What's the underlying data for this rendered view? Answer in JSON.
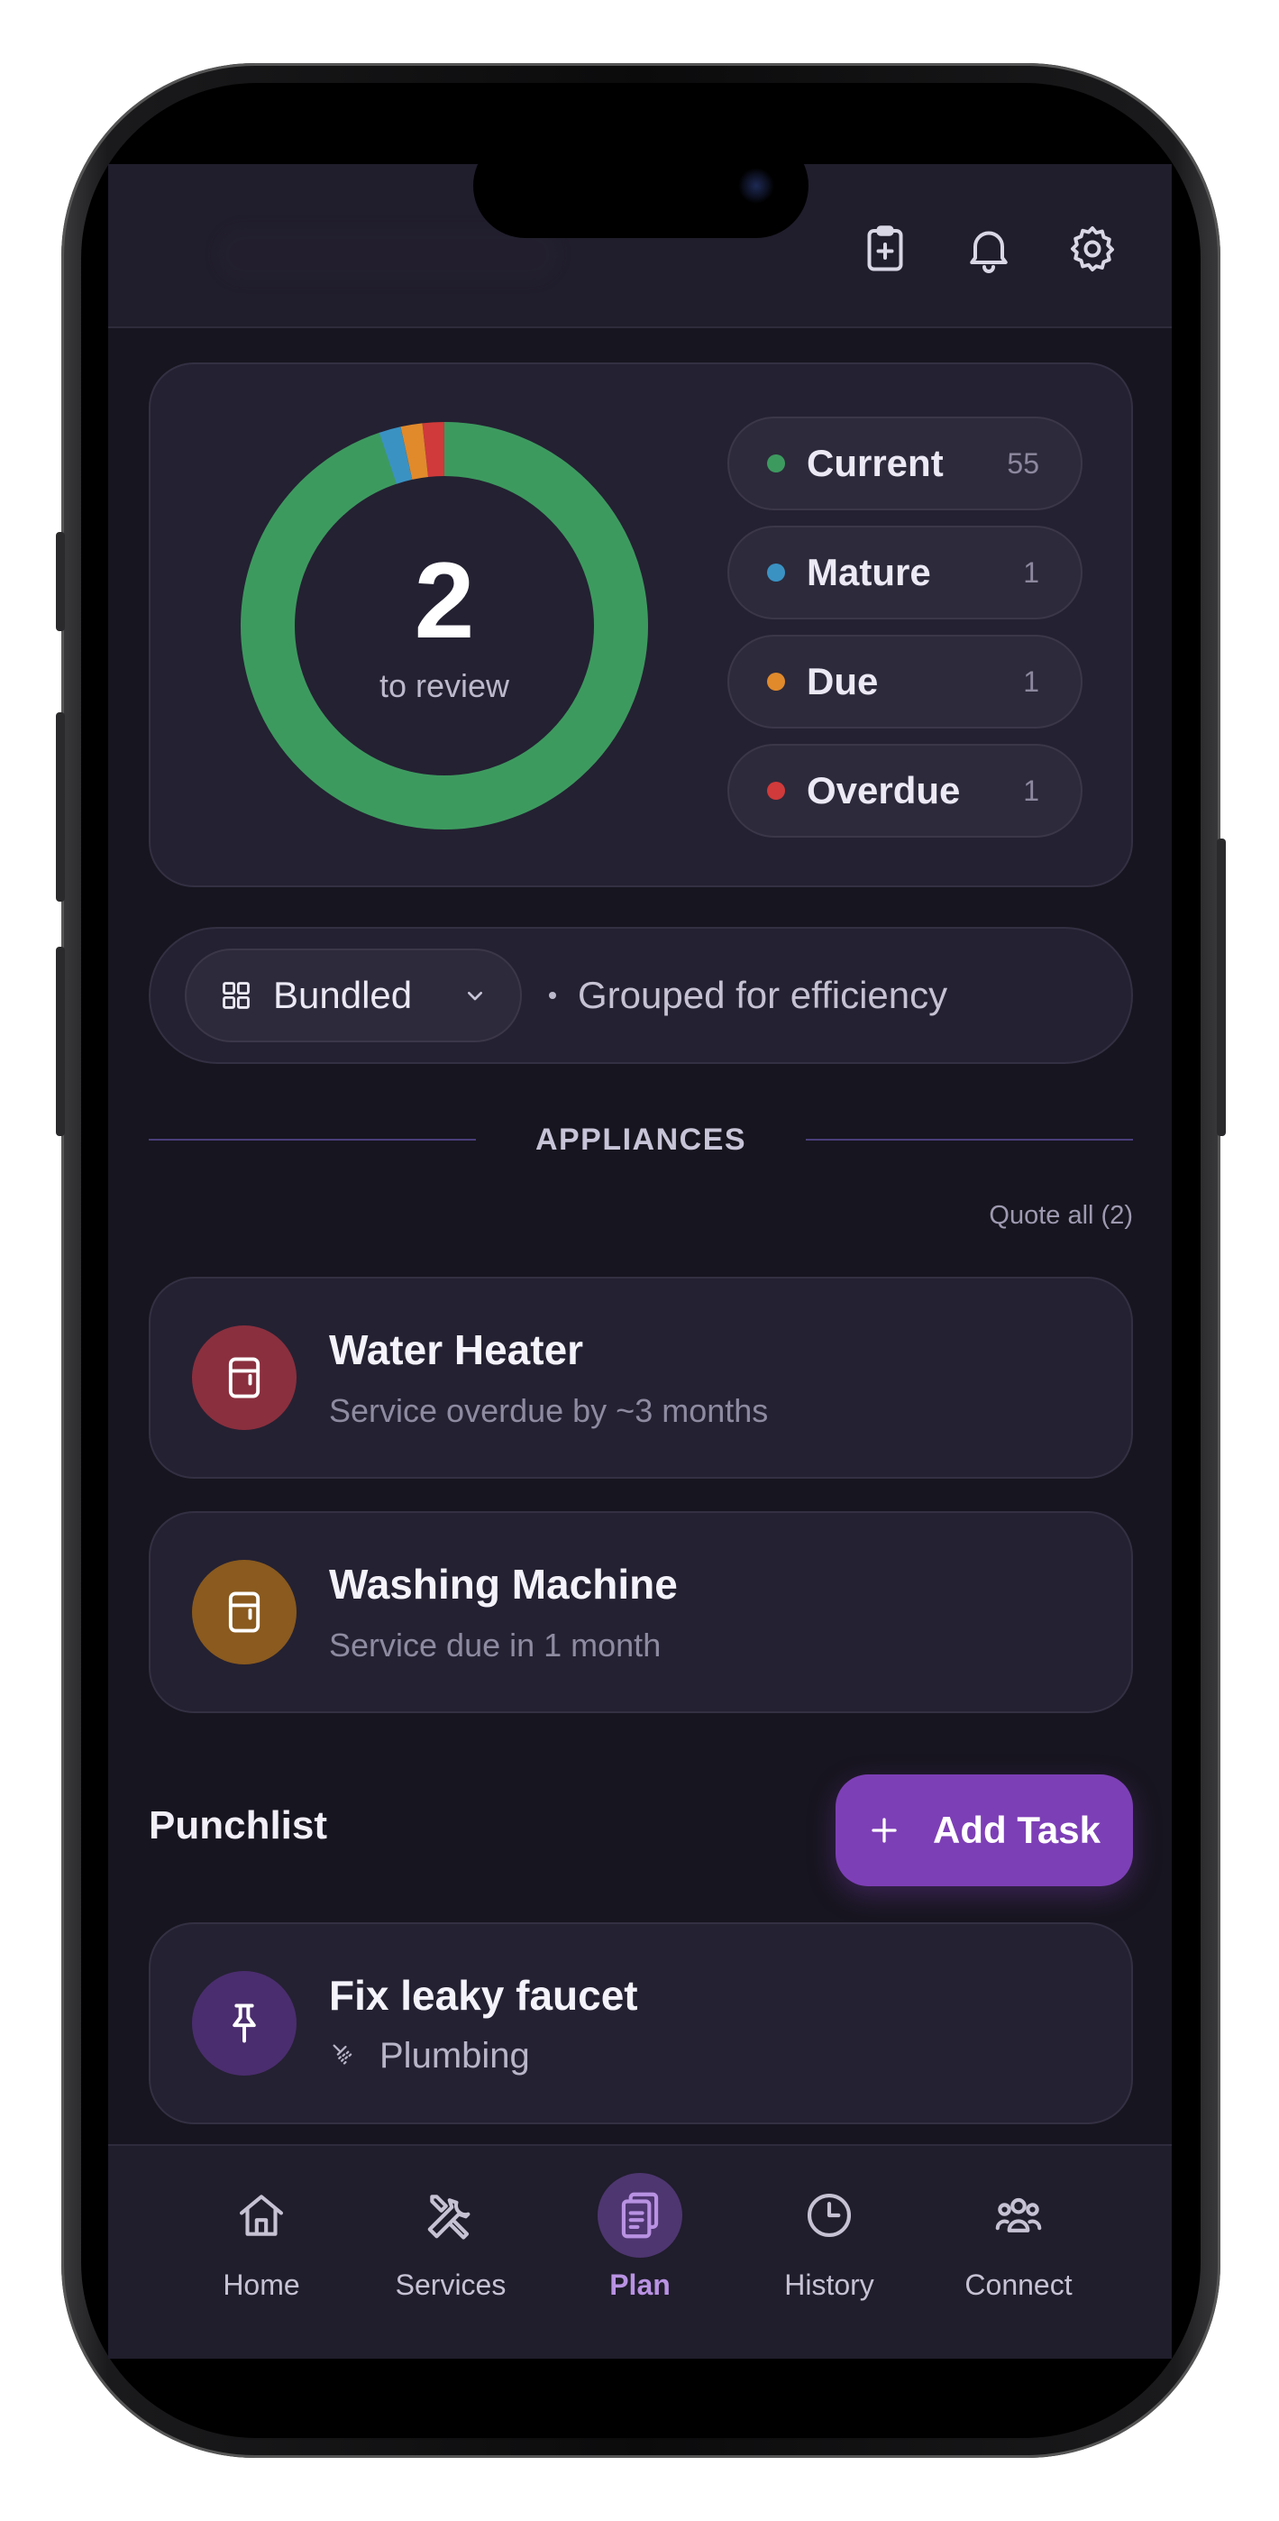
{
  "header": {
    "icons": [
      "clipboard-plus-icon",
      "bell-icon",
      "gear-icon"
    ]
  },
  "summary": {
    "count": "2",
    "count_label": "to review",
    "legend": [
      {
        "label": "Current",
        "count": "55",
        "color": "#3d9a5f"
      },
      {
        "label": "Mature",
        "count": "1",
        "color": "#3a92c3"
      },
      {
        "label": "Due",
        "count": "1",
        "color": "#e08a2c"
      },
      {
        "label": "Overdue",
        "count": "1",
        "color": "#d03a3a"
      }
    ]
  },
  "chart_data": {
    "type": "pie",
    "categories": [
      "Current",
      "Mature",
      "Due",
      "Overdue"
    ],
    "values": [
      55,
      1,
      1,
      1
    ]
  },
  "view_mode": {
    "selected": "Bundled",
    "description": "Grouped for efficiency"
  },
  "appliances": {
    "section_title": "APPLIANCES",
    "quote_all": "Quote all (2)",
    "items": [
      {
        "title": "Water Heater",
        "subtitle": "Service overdue by ~3 months",
        "color": "#8a2f3e"
      },
      {
        "title": "Washing Machine",
        "subtitle": "Service due in 1 month",
        "color": "#8a5a1e"
      }
    ]
  },
  "punchlist": {
    "title": "Punchlist",
    "add_label": "Add Task",
    "items": [
      {
        "title": "Fix leaky faucet",
        "category": "Plumbing",
        "color": "#4a2d6e"
      }
    ]
  },
  "nav": {
    "items": [
      {
        "label": "Home",
        "icon": "home-icon"
      },
      {
        "label": "Services",
        "icon": "tools-icon"
      },
      {
        "label": "Plan",
        "icon": "clipboard-icon",
        "active": true
      },
      {
        "label": "History",
        "icon": "clock-icon"
      },
      {
        "label": "Connect",
        "icon": "people-icon"
      }
    ]
  }
}
